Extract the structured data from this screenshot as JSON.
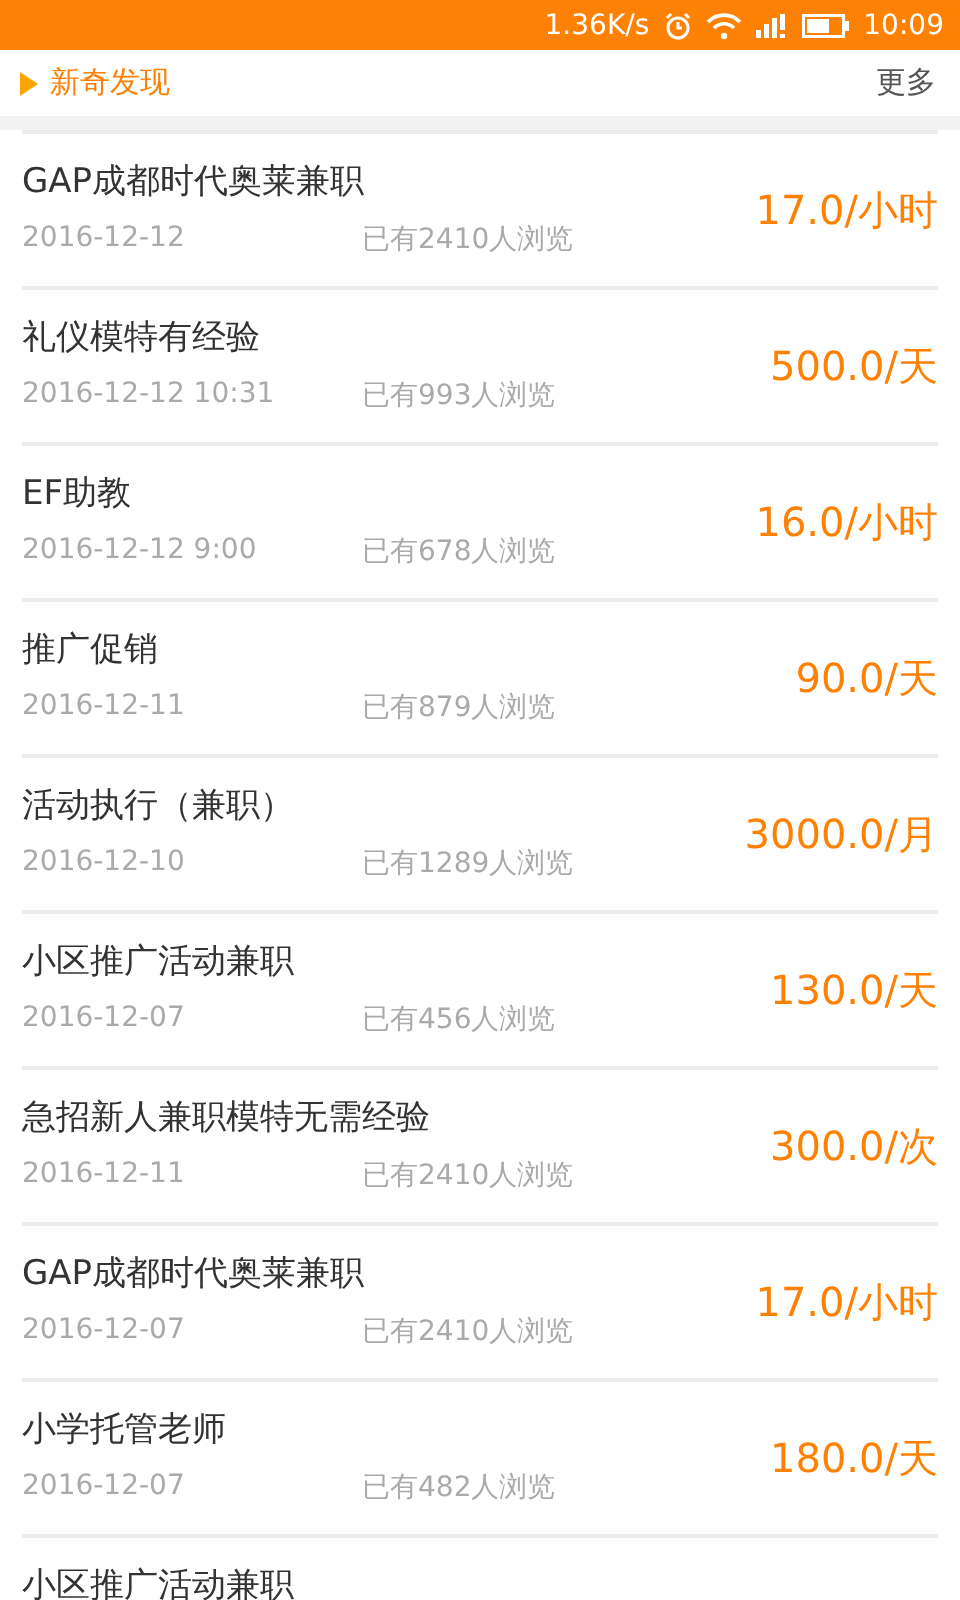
{
  "status_bar": {
    "speed": "1.36K/s",
    "time": "10:09"
  },
  "header": {
    "title": "新奇发现",
    "more": "更多"
  },
  "jobs": [
    {
      "title": "GAP成都时代奥莱兼职",
      "date": "2016-12-12",
      "views": "已有2410人浏览",
      "pay": "17.0/小时"
    },
    {
      "title": "礼仪模特有经验",
      "date": "2016-12-12 10:31",
      "views": "已有993人浏览",
      "pay": "500.0/天"
    },
    {
      "title": "EF助教",
      "date": "2016-12-12 9:00",
      "views": "已有678人浏览",
      "pay": "16.0/小时"
    },
    {
      "title": "推广促销",
      "date": "2016-12-11",
      "views": "已有879人浏览",
      "pay": "90.0/天"
    },
    {
      "title": "活动执行（兼职）",
      "date": "2016-12-10",
      "views": "已有1289人浏览",
      "pay": "3000.0/月"
    },
    {
      "title": "小区推广活动兼职",
      "date": "2016-12-07",
      "views": "已有456人浏览",
      "pay": "130.0/天"
    },
    {
      "title": "急招新人兼职模特无需经验",
      "date": "2016-12-11",
      "views": "已有2410人浏览",
      "pay": "300.0/次"
    },
    {
      "title": "GAP成都时代奥莱兼职",
      "date": "2016-12-07",
      "views": "已有2410人浏览",
      "pay": "17.0/小时"
    },
    {
      "title": "小学托管老师",
      "date": "2016-12-07",
      "views": "已有482人浏览",
      "pay": "180.0/天"
    },
    {
      "title": "小区推广活动兼职"
    }
  ]
}
